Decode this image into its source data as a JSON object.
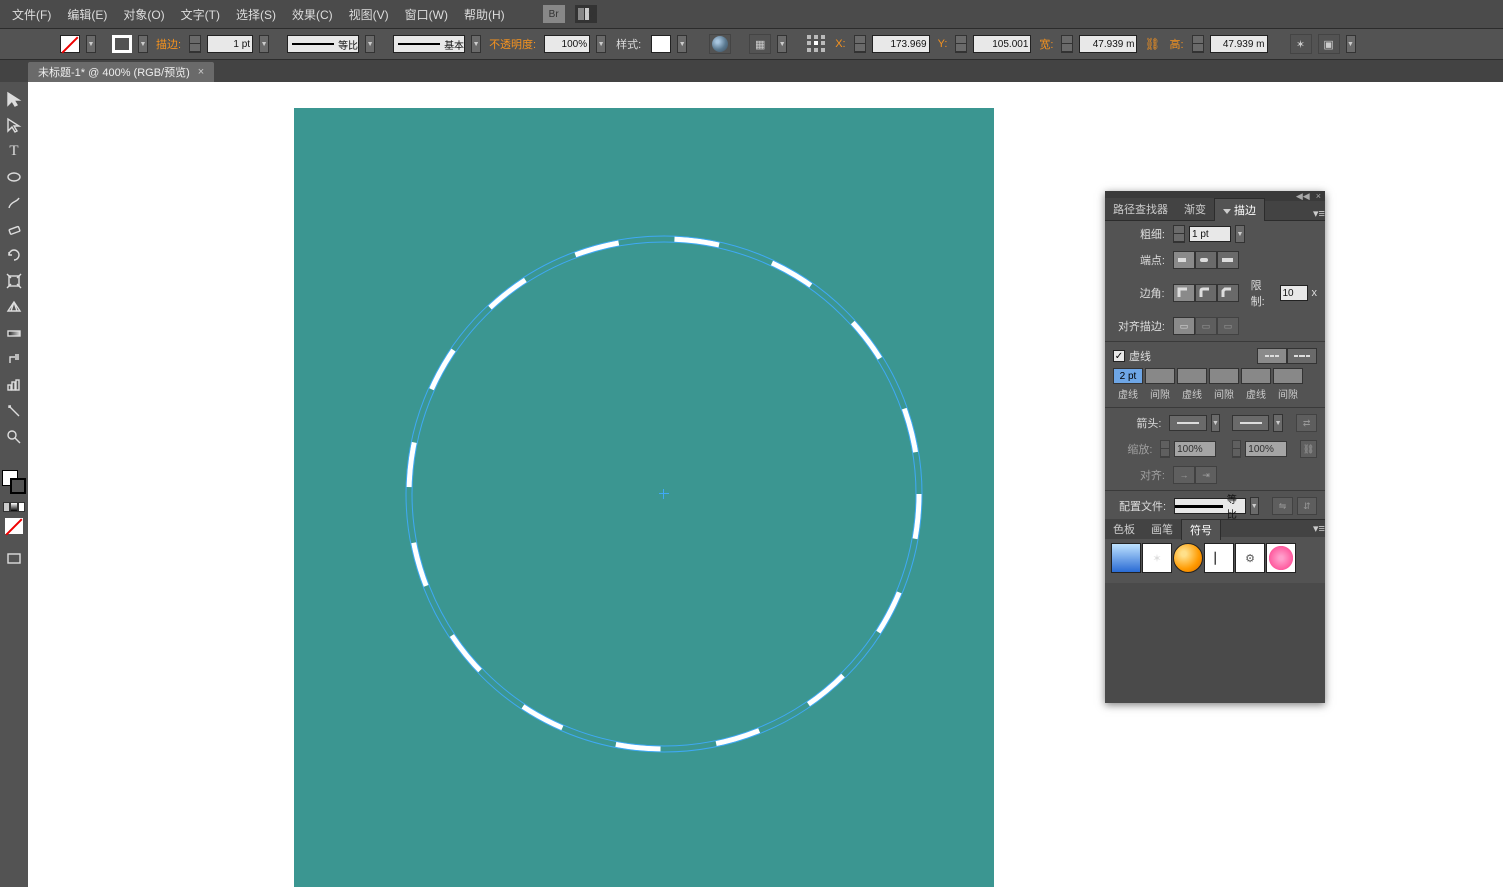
{
  "menu": {
    "file": "文件(F)",
    "edit": "编辑(E)",
    "object": "对象(O)",
    "type": "文字(T)",
    "select": "选择(S)",
    "effect": "效果(C)",
    "view": "视图(V)",
    "window": "窗口(W)",
    "help": "帮助(H)",
    "br": "Br"
  },
  "optbar": {
    "stroke_label": "描边:",
    "stroke_weight": "1 pt",
    "brush_label": "等比",
    "style_label": "基本",
    "opacity_label": "不透明度:",
    "opacity_value": "100%",
    "styleHead": "样式:",
    "x_label": "X:",
    "x_val": "173.969",
    "y_label": "Y:",
    "y_val": "105.001",
    "w_label": "宽:",
    "w_val": "47.939 m",
    "h_label": "高:",
    "h_val": "47.939 m"
  },
  "doc": {
    "tab": "未标题-1* @ 400% (RGB/预览)"
  },
  "panel": {
    "tabs": {
      "pathfinder": "路径查找器",
      "gradient": "渐变",
      "stroke": "描边"
    },
    "weight_label": "粗细:",
    "weight_val": "1 pt",
    "cap_label": "端点:",
    "corner_label": "边角:",
    "limit_label": "限制:",
    "limit_val": "10",
    "limit_unit": "x",
    "align_label": "对齐描边:",
    "dash_check": "虚线",
    "dash_vals": [
      "2 pt",
      "",
      "",
      "",
      "",
      ""
    ],
    "dash_cols": [
      "虚线",
      "间隙",
      "虚线",
      "间隙",
      "虚线",
      "间隙"
    ],
    "arrow_label": "箭头:",
    "scale_label": "缩放:",
    "scale_val": "100%",
    "alignArrow_label": "对齐:",
    "profile_label": "配置文件:",
    "profile_val": "等比"
  },
  "panel2": {
    "swatches": "色板",
    "brushes": "画笔",
    "symbols": "符号"
  }
}
